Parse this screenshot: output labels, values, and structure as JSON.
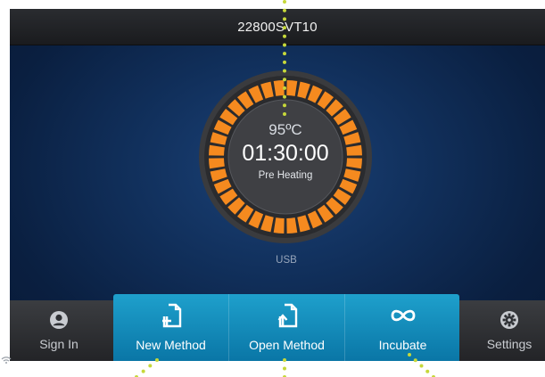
{
  "device": {
    "title": "22800SVT10"
  },
  "timer": {
    "temperature": "95ºC",
    "time": "01:30:00",
    "phase": "Pre Heating"
  },
  "usb_label": "USB",
  "nav": {
    "sign_in": {
      "label": "Sign In",
      "icon": "user-icon"
    },
    "new_method": {
      "label": "New Method",
      "icon": "new-file-icon"
    },
    "open_method": {
      "label": "Open Method",
      "icon": "open-file-icon"
    },
    "incubate": {
      "label": "Incubate",
      "icon": "infinity-icon"
    },
    "settings": {
      "label": "Settings",
      "icon": "gear-icon"
    }
  },
  "colors": {
    "accent_orange": "#f58a1f",
    "button_blue": "#1a93c4",
    "callout_dots": "#c6d83a"
  }
}
